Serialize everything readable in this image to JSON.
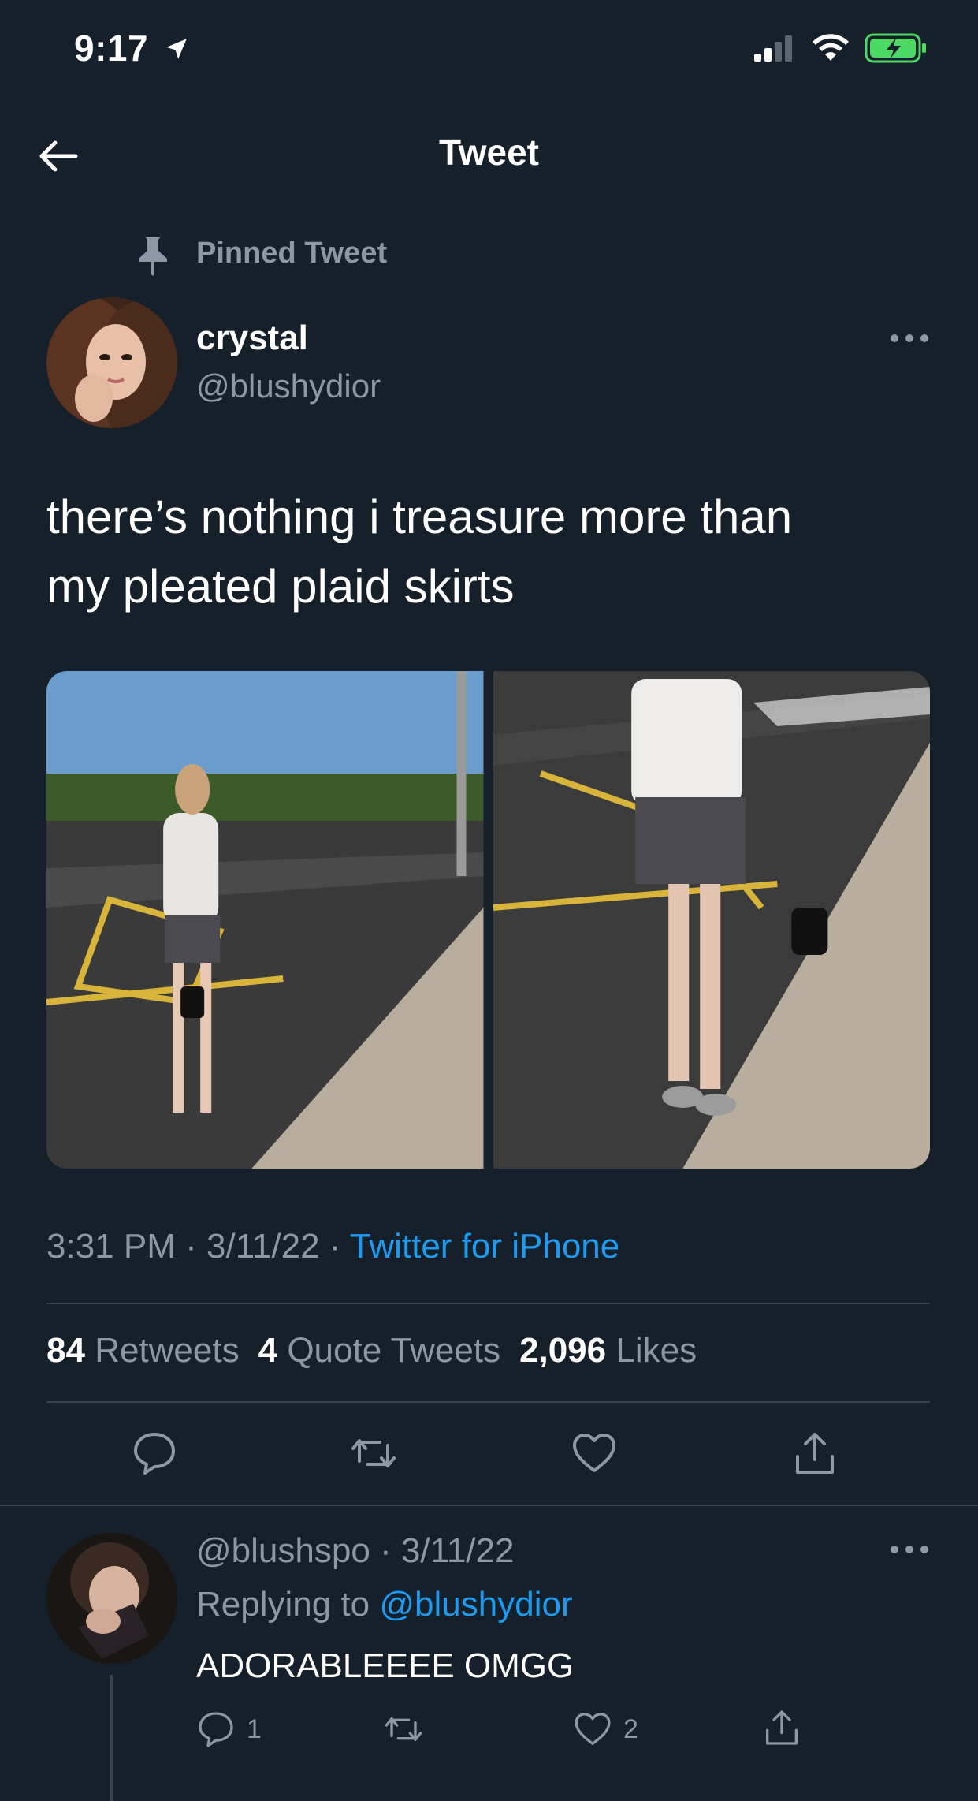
{
  "status_bar": {
    "time": "9:17"
  },
  "header": {
    "title": "Tweet"
  },
  "tweet": {
    "pinned_label": "Pinned Tweet",
    "author_name": "crystal",
    "author_handle": "@blushydior",
    "text_line1": "there’s nothing i treasure more than",
    "text_line2": "my pleated plaid skirts",
    "time": "3:31 PM",
    "date": "3/11/22",
    "source": "Twitter for iPhone",
    "retweets_count": "84",
    "retweets_label": "Retweets",
    "quotes_count": "4",
    "quotes_label": "Quote Tweets",
    "likes_count": "2,096",
    "likes_label": "Likes"
  },
  "reply": {
    "handle": "@blushspo",
    "date": "3/11/22",
    "replying_to_label": "Replying to",
    "replying_to_handle": "@blushydior",
    "text": "ADORABLEEEE OMGG",
    "reply_count": "1",
    "like_count": "2"
  },
  "colors": {
    "background": "#15202b",
    "text": "#ffffff",
    "muted": "#8b98a5",
    "link": "#1d9bf0",
    "divider": "#38444d",
    "battery": "#4cd964"
  }
}
